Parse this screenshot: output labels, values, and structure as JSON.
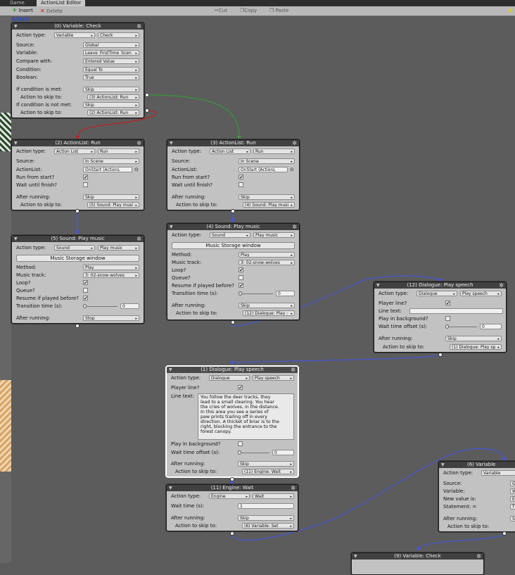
{
  "tabs": [
    "Game",
    "ActionList Editor"
  ],
  "toolbar": {
    "insert": "Insert",
    "delete": "Delete",
    "cut": "Cut",
    "copy": "Copy",
    "paste": "Paste"
  },
  "start_label": "START",
  "colors": {
    "canvas": "#5c5c5c",
    "node": "#c2c2c2",
    "header": "#414141",
    "wire_pass": "#2fa32f",
    "wire_fail": "#d01818",
    "wire_default": "#4455ee"
  },
  "nodes": {
    "n0": {
      "title": "(0) Variable: Check",
      "action_type_label": "Action type:",
      "action_type": "Variable",
      "action_sub": "Check",
      "source_label": "Source:",
      "source": "Global",
      "variable_label": "Variable:",
      "variable": "Leave_FirstTime_Scen",
      "compare_label": "Compare with:",
      "compare": "Entered Value",
      "condition_label": "Condition:",
      "condition": "Equal To",
      "boolean_label": "Boolean:",
      "boolean": "True",
      "if_met_label": "If condition is met:",
      "if_met": "Skip",
      "skip1_label": "Action to skip to:",
      "skip1": "(3) ActionList: Run",
      "if_not_label": "If condition is not met:",
      "if_not": "Skip",
      "skip2_label": "Action to skip to:",
      "skip2": "(2) ActionList: Run"
    },
    "n2": {
      "title": "(2) ActionList: Run",
      "action_type_label": "Action type:",
      "action_type": "Action List",
      "action_sub": "Run",
      "source_label": "Source:",
      "source": "In Scene",
      "actionlist_label": "ActionList:",
      "actionlist": "OnStart (ActionL",
      "run_start_label": "Run from start?",
      "run_start": true,
      "wait_label": "Wait until finish?",
      "wait": false,
      "after_label": "After running:",
      "after": "Skip",
      "skip_label": "Action to skip to:",
      "skip": "(5) Sound: Play musi"
    },
    "n3": {
      "title": "(3) ActionList: Run",
      "action_type_label": "Action type:",
      "action_type": "Action List",
      "action_sub": "Run",
      "source_label": "Source:",
      "source": "In Scene",
      "actionlist_label": "ActionList:",
      "actionlist": "OnStart (ActionL",
      "run_start_label": "Run from start?",
      "run_start": true,
      "wait_label": "Wait until finish?",
      "wait": false,
      "after_label": "After running:",
      "after": "Skip",
      "skip_label": "Action to skip to:",
      "skip": "(4) Sound: Play musi"
    },
    "n5": {
      "title": "(5) Sound: Play music",
      "action_type_label": "Action type:",
      "action_type": "Sound",
      "action_sub": "Play music",
      "window_btn": "Music Storage window",
      "method_label": "Method:",
      "method": "Play",
      "track_label": "Music track:",
      "track": "3: 02-snow-wolves",
      "loop_label": "Loop?",
      "loop": true,
      "queue_label": "Queue?",
      "queue": false,
      "resume_label": "Resume if played before?",
      "resume": true,
      "transition_label": "Transition time (s):",
      "transition": "0",
      "after_label": "After running:",
      "after": "Stop"
    },
    "n4": {
      "title": "(4) Sound: Play music",
      "action_type_label": "Action type:",
      "action_type": "Sound",
      "action_sub": "Play music",
      "window_btn": "Music Storage window",
      "method_label": "Method:",
      "method": "Play",
      "track_label": "Music track:",
      "track": "3: 02-snow-wolves",
      "loop_label": "Loop?",
      "loop": true,
      "queue_label": "Queue?",
      "queue": false,
      "resume_label": "Resume if played before?",
      "resume": true,
      "transition_label": "Transition time (s):",
      "transition": "0",
      "after_label": "After running:",
      "after": "Skip",
      "skip_label": "Action to skip to:",
      "skip": "(12) Dialogue: Play :"
    },
    "n12": {
      "title": "(12) Dialogue: Play speech",
      "action_type_label": "Action type:",
      "action_type": "Dialogue",
      "action_sub": "Play speech",
      "player_label": "Player line?",
      "player": true,
      "line_label": "Line text:",
      "line": "",
      "bg_label": "Play in background?",
      "bg": false,
      "offset_label": "Wait time offset (s):",
      "offset": "0",
      "after_label": "After running:",
      "after": "Skip",
      "skip_label": "Action to skip to:",
      "skip": "(1) Dialogue: Play sp"
    },
    "n1": {
      "title": "(1) Dialogue: Play speech",
      "action_type_label": "Action type:",
      "action_type": "Dialogue",
      "action_sub": "Play speech",
      "player_label": "Player line?",
      "player": true,
      "line_label": "Line text:",
      "line": "You follow the deer tracks, they\nlead to a small clearing. You hear\nthe cries of wolves, in the distance.\nIn this area you see a series of\npaw prints trailing off in every\ndirection. A thicket of briar is to the\nright, blocking the entrance to the\nforest canopy.",
      "bg_label": "Play in background?",
      "bg": false,
      "offset_label": "Wait time offset (s):",
      "offset": "0",
      "after_label": "After running:",
      "after": "Skip",
      "skip_label": "Action to skip to:",
      "skip": "(11) Engine: Wait"
    },
    "n11": {
      "title": "(11) Engine: Wait",
      "action_type_label": "Action type:",
      "action_type": "Engine",
      "action_sub": "Wait",
      "wait_label": "Wait time (s):",
      "wait": "1",
      "after_label": "After running:",
      "after": "Skip",
      "skip_label": "Action to skip to:",
      "skip": "(6) Variable: Set"
    },
    "n6": {
      "title": "(6) Variable",
      "action_type_label": "Action type:",
      "action_type": "Variable",
      "source_label": "Source:",
      "source": "G",
      "variable_label": "Variable:",
      "variable": "W",
      "newval_label": "New value is:",
      "newval": "E",
      "statement_label": "Statement: =",
      "statement": "T",
      "after_label": "After running:",
      "after": "S",
      "skip_label": "Action to skip to:"
    },
    "n9": {
      "title": "(9) Variable: Check"
    }
  }
}
